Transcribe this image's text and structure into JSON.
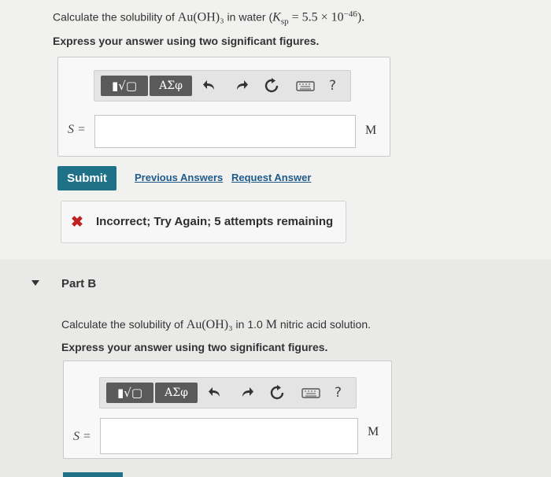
{
  "part_a": {
    "question_prefix": "Calculate the solubility of ",
    "compound": "Au(OH)₃",
    "question_mid": " in water (",
    "ksp_expr": "K",
    "ksp_sub": "sp",
    "ksp_value": " = 5.5 × 10",
    "ksp_exp": "−46",
    "question_suffix": ").",
    "instruction": "Express your answer using two significant figures.",
    "toolbar": {
      "templates_label": "▮√▢",
      "greek_label": "ΑΣφ",
      "help_label": "?"
    },
    "variable_label": "S =",
    "answer_value": "",
    "unit": "M",
    "submit_label": "Submit",
    "previous_answers_label": "Previous Answers",
    "request_answer_label": "Request Answer",
    "feedback_icon": "✖",
    "feedback_text": "Incorrect; Try Again; 5 attempts remaining"
  },
  "part_b": {
    "title": "Part B",
    "question_prefix": "Calculate the solubility of ",
    "compound": "Au(OH)₃",
    "question_mid": " in 1.0 ",
    "concentration_unit": "M",
    "question_suffix": " nitric acid solution.",
    "instruction": "Express your answer using two significant figures.",
    "toolbar": {
      "templates_label": "▮√▢",
      "greek_label": "ΑΣφ",
      "help_label": "?"
    },
    "variable_label": "S =",
    "answer_value": "",
    "unit": "M"
  },
  "colors": {
    "submit": "#1f7188",
    "link": "#1e5a8a",
    "error": "#c02020"
  }
}
